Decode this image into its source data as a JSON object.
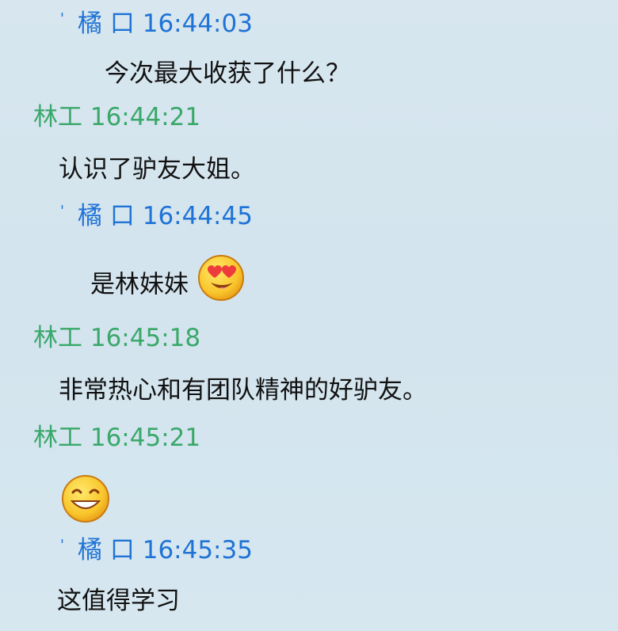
{
  "messages": [
    {
      "sender": "橘 口",
      "time": "16:44:03",
      "text": "今次最大收获了什么？",
      "emoji": ""
    },
    {
      "sender": "林工",
      "time": "16:44:21",
      "text": "认识了驴友大姐。",
      "emoji": ""
    },
    {
      "sender": "橘 口",
      "time": "16:44:45",
      "text": "是林妹妹",
      "emoji": "heart-eyes-emoji"
    },
    {
      "sender": "林工",
      "time": "16:45:18",
      "text": "非常热心和有团队精神的好驴友。",
      "emoji": ""
    },
    {
      "sender": "林工",
      "time": "16:45:21",
      "text": "",
      "emoji": "grin-emoji"
    },
    {
      "sender": "橘 口",
      "time": "16:45:35",
      "text": "这值得学习",
      "emoji": ""
    }
  ],
  "colors": {
    "self_header": "#1f73d6",
    "other_header": "#3aa86a",
    "message_text": "#111111",
    "background": "#d6e6ef"
  }
}
